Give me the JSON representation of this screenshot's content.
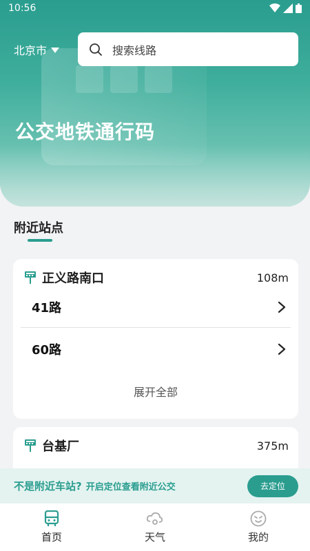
{
  "status_bar": {
    "time": "10:56"
  },
  "header": {
    "city": "北京市",
    "search_placeholder": "搜索线路",
    "hero_title": "公交地铁通行码"
  },
  "section": {
    "title": "附近站点"
  },
  "stops": [
    {
      "name": "正义路南口",
      "distance": "108m",
      "routes": [
        "41路",
        "60路"
      ],
      "expand_label": "展开全部"
    },
    {
      "name": "台基厂",
      "distance": "375m"
    }
  ],
  "location_banner": {
    "question": "不是附近车站?",
    "hint": "开启定位查看附近公交",
    "button": "去定位"
  },
  "bottom_nav": {
    "items": [
      {
        "label": "首页",
        "icon": "bus-icon"
      },
      {
        "label": "天气",
        "icon": "weather-icon"
      },
      {
        "label": "我的",
        "icon": "smiley-icon"
      }
    ]
  },
  "colors": {
    "accent": "#2a9d8f",
    "banner_bg": "#e4f3f0"
  }
}
